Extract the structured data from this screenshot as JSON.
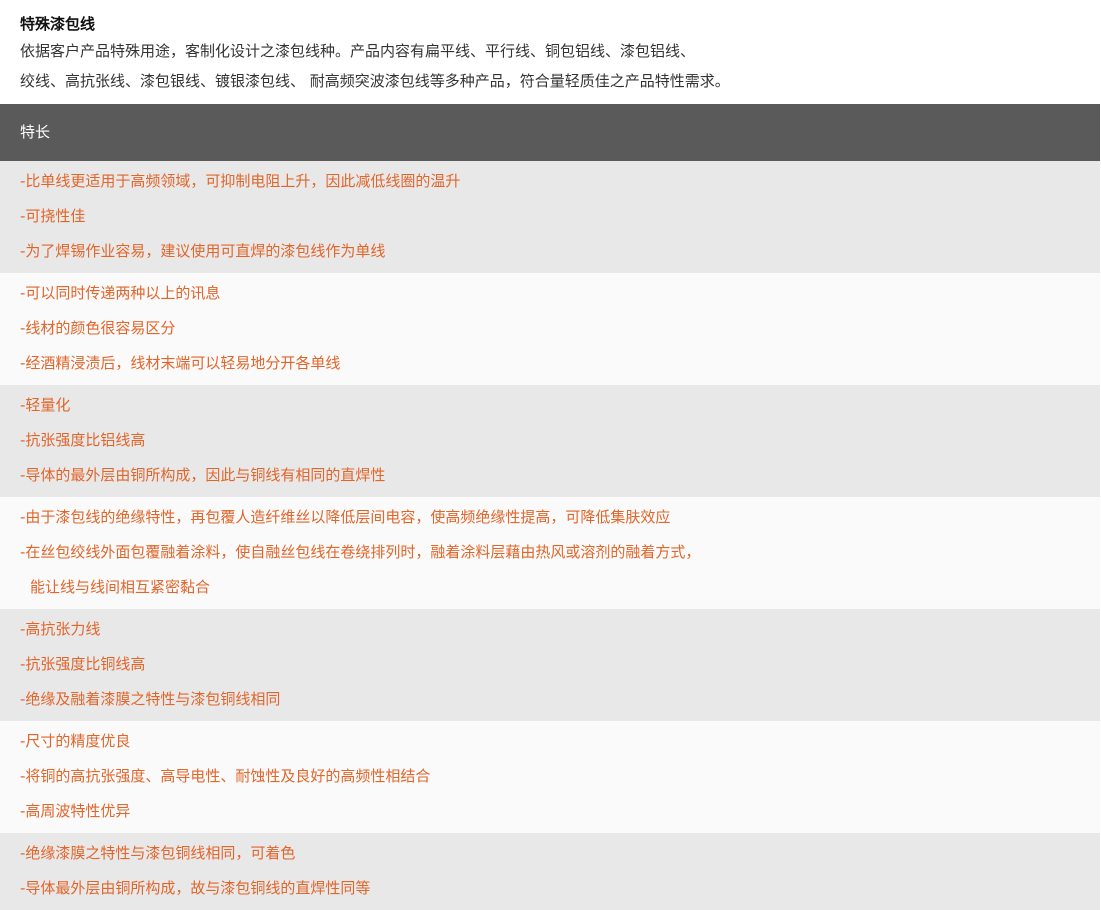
{
  "intro": {
    "title": "特殊漆包线",
    "lines": [
      "依据客户产品特殊用途，客制化设计之漆包线种。产品内容有扁平线、平行线、铜包铝线、漆包铝线、",
      "绞线、高抗张线、漆包银线、镀银漆包线、 耐高频突波漆包线等多种产品，符合量轻质佳之产品特性需求。"
    ]
  },
  "table": {
    "header": "特长",
    "colors": {
      "header_bg": "#5b5a5b",
      "row_dark": "#e8e8e8",
      "row_light": "#fafafa",
      "accent_text": "#e2652a"
    },
    "groups": [
      {
        "lines": [
          "-比单线更适用于高频领域，可抑制电阻上升，因此减低线圈的温升",
          "-可挠性佳",
          "-为了焊锡作业容易，建议使用可直焊的漆包线作为单线"
        ]
      },
      {
        "lines": [
          "-可以同时传递两种以上的讯息",
          "-线材的颜色很容易区分",
          "-经酒精浸渍后，线材末端可以轻易地分开各单线"
        ]
      },
      {
        "lines": [
          "-轻量化",
          "-抗张强度比铝线高",
          "-导体的最外层由铜所构成，因此与铜线有相同的直焊性"
        ]
      },
      {
        "lines": [
          "-由于漆包线的绝缘特性，再包覆人造纤维丝以降低层间电容，使高频绝缘性提高，可降低集肤效应",
          "-在丝包绞线外面包覆融着涂料，使自融丝包线在卷绕排列时，融着涂料层藉由热风或溶剂的融着方式，",
          "能让线与线间相互紧密黏合"
        ]
      },
      {
        "lines": [
          "-高抗张力线",
          "-抗张强度比铜线高",
          "-绝缘及融着漆膜之特性与漆包铜线相同"
        ]
      },
      {
        "lines": [
          "-尺寸的精度优良",
          "-将铜的高抗张强度、高导电性、耐蚀性及良好的高频性相结合",
          "-高周波特性优异"
        ]
      },
      {
        "lines": [
          "-绝缘漆膜之特性与漆包铜线相同，可着色",
          "-导体最外层由铜所构成，故与漆包铜线的直焊性同等"
        ]
      }
    ]
  }
}
